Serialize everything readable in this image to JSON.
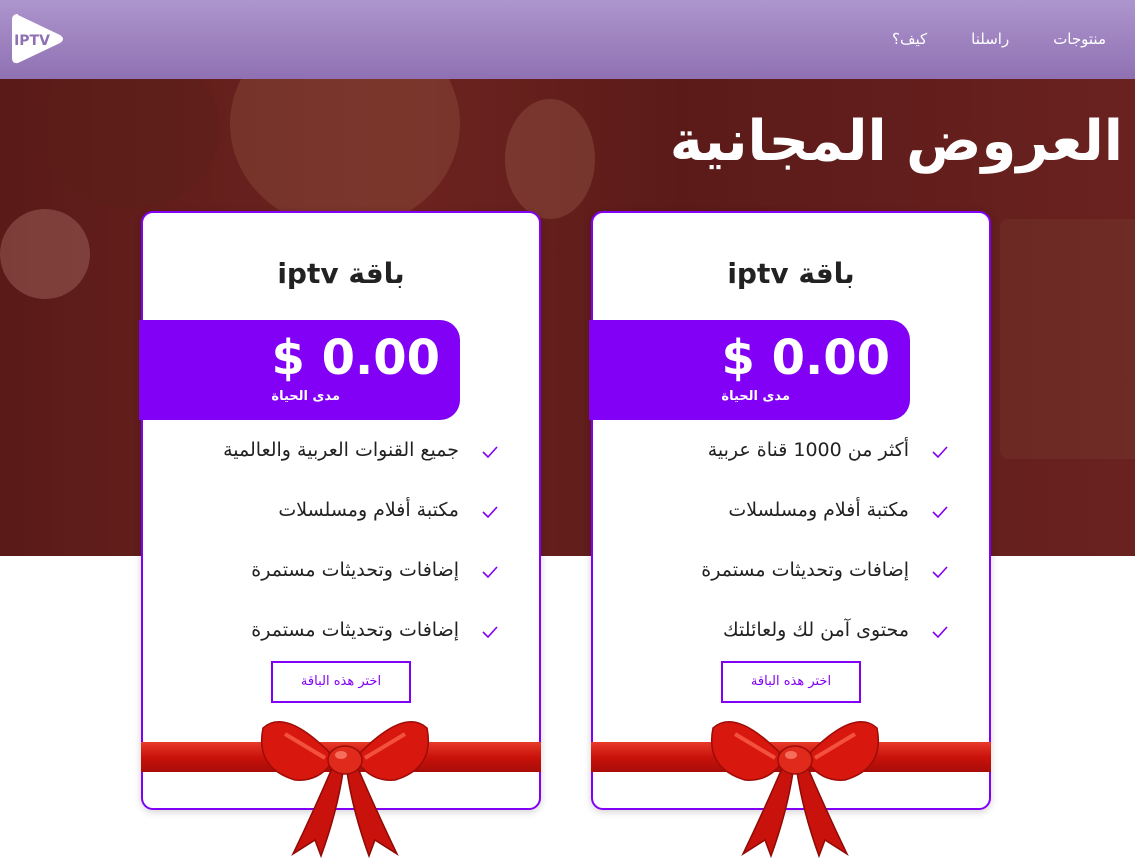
{
  "header": {
    "logo_text": "IPTV",
    "nav": [
      {
        "label": "منتوجات"
      },
      {
        "label": "راسلنا"
      },
      {
        "label": "كيف؟"
      }
    ]
  },
  "hero": {
    "title": "العروض المجانية"
  },
  "cards": [
    {
      "title": "باقة iptv",
      "price": "$ 0.00",
      "duration": "مدى الحياة",
      "features": [
        "أكثر من 1000 قناة عربية",
        "مكتبة أفلام ومسلسلات",
        "إضافات وتحديثات مستمرة",
        "محتوى آمن لك ولعائلتك"
      ],
      "button_label": "اختر هذه الباقة"
    },
    {
      "title": "باقة iptv",
      "price": "$ 0.00",
      "duration": "مدى الحياة",
      "features": [
        "جميع القنوات العربية والعالمية",
        "مكتبة أفلام ومسلسلات",
        "إضافات وتحديثات مستمرة",
        "إضافات وتحديثات مستمرة"
      ],
      "button_label": "اختر هذه الباقة"
    }
  ],
  "icons": {
    "logo": "play-icon",
    "feature": "check-icon",
    "ribbon": "gift-bow-icon"
  },
  "colors": {
    "accent": "#8100f5",
    "header": "#9d82c1",
    "hero": "#6a201e",
    "ribbon": "#d0130d"
  }
}
